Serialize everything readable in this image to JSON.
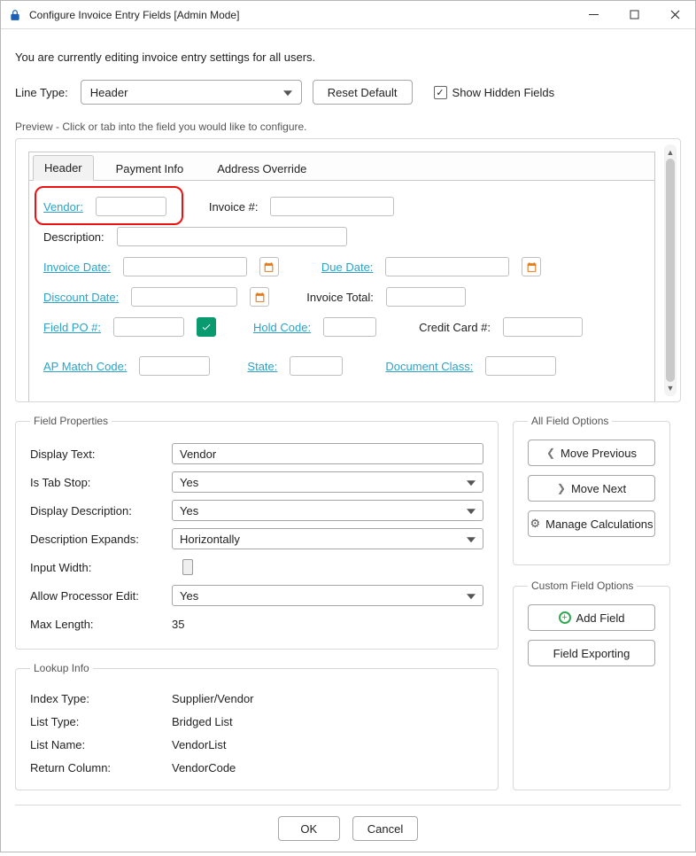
{
  "titlebar": {
    "title": "Configure Invoice Entry Fields [Admin Mode]"
  },
  "infoLine": "You are currently editing invoice entry settings for all users.",
  "topRow": {
    "lineTypeLabel": "Line Type:",
    "lineTypeValue": "Header",
    "resetLabel": "Reset Default",
    "showHiddenLabel": "Show Hidden Fields",
    "showHiddenChecked": true
  },
  "preview": {
    "groupLabel": "Preview - Click or tab into the field you would like to configure.",
    "tabs": [
      "Header",
      "Payment Info",
      "Address Override"
    ],
    "activeTab": 0,
    "labels": {
      "vendor": "Vendor:",
      "invoiceNum": "Invoice #:",
      "description": "Description:",
      "invoiceDate": "Invoice Date:",
      "dueDate": "Due Date:",
      "discountDate": "Discount Date:",
      "invoiceTotal": "Invoice Total:",
      "fieldPO": "Field PO #:",
      "holdCode": "Hold Code:",
      "creditCard": "Credit Card #:",
      "apMatchCode": "AP Match Code:",
      "state": "State:",
      "documentClass": "Document Class:"
    }
  },
  "fieldProps": {
    "legend": "Field Properties",
    "rows": {
      "displayTextLabel": "Display Text:",
      "displayTextValue": "Vendor",
      "isTabStopLabel": "Is Tab Stop:",
      "isTabStopValue": "Yes",
      "displayDescLabel": "Display Description:",
      "displayDescValue": "Yes",
      "descExpandsLabel": "Description Expands:",
      "descExpandsValue": "Horizontally",
      "inputWidthLabel": "Input Width:",
      "allowProcEditLabel": "Allow Processor Edit:",
      "allowProcEditValue": "Yes",
      "maxLengthLabel": "Max Length:",
      "maxLengthValue": "35"
    }
  },
  "lookupInfo": {
    "legend": "Lookup Info",
    "rows": {
      "indexTypeLabel": "Index Type:",
      "indexTypeValue": "Supplier/Vendor",
      "listTypeLabel": "List Type:",
      "listTypeValue": "Bridged List",
      "listNameLabel": "List Name:",
      "listNameValue": "VendorList",
      "returnColLabel": "Return Column:",
      "returnColValue": "VendorCode"
    }
  },
  "allFieldOptions": {
    "legend": "All Field Options",
    "movePrev": "Move Previous",
    "moveNext": "Move Next",
    "manageCalc": "Manage Calculations"
  },
  "customFieldOptions": {
    "legend": "Custom Field Options",
    "addField": "Add Field",
    "fieldExporting": "Field Exporting"
  },
  "footer": {
    "ok": "OK",
    "cancel": "Cancel"
  }
}
